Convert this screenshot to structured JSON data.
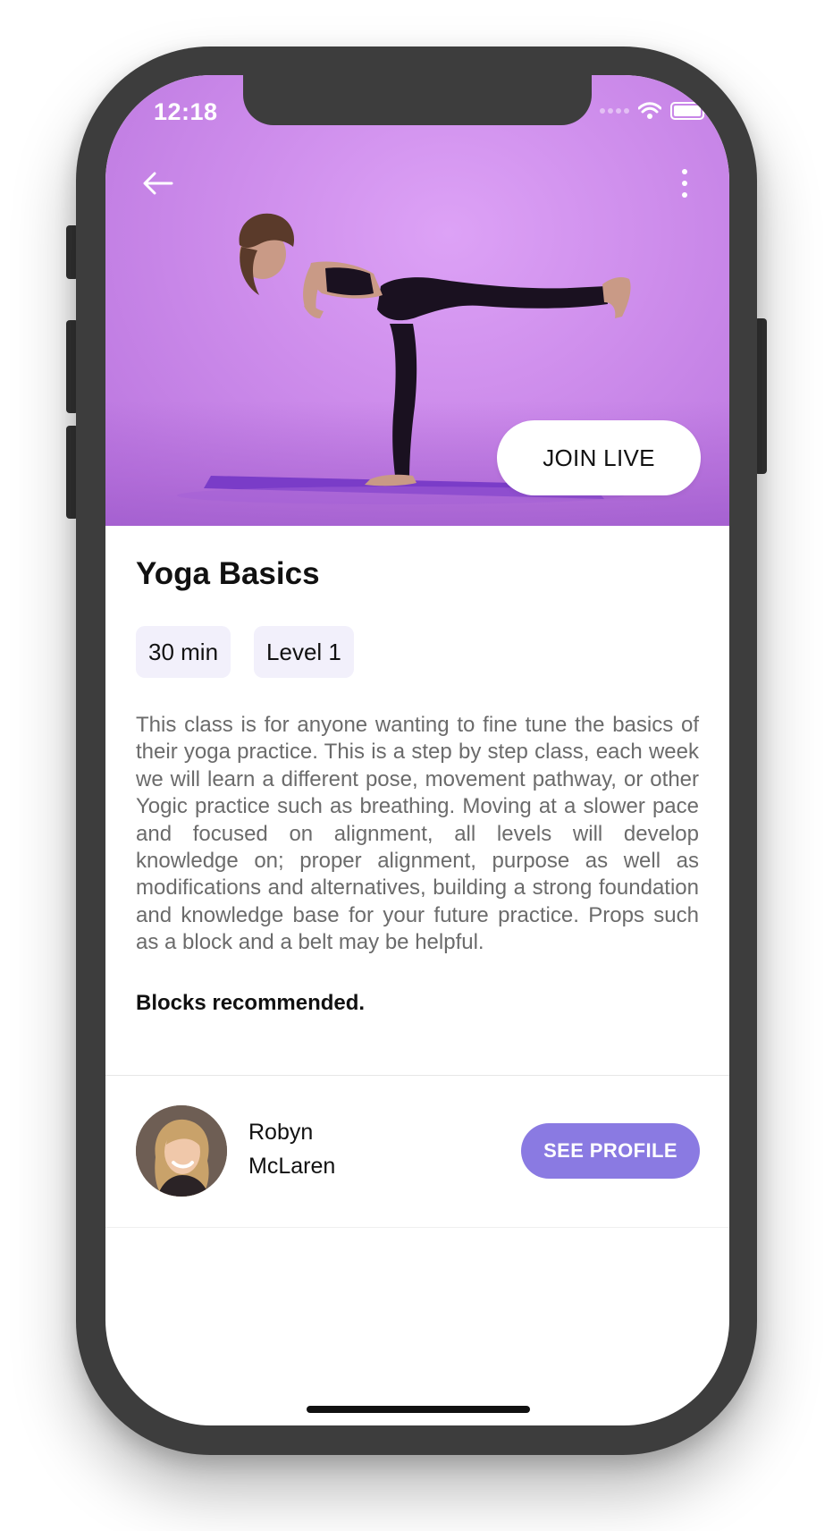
{
  "status_bar": {
    "time": "12:18",
    "icons": [
      "signal-dots-icon",
      "wifi-icon",
      "battery-icon"
    ]
  },
  "hero": {
    "back_icon": "arrow-left-icon",
    "more_icon": "more-vertical-icon",
    "join_label": "JOIN LIVE",
    "background_color": "#cd8ceb"
  },
  "class_info": {
    "title": "Yoga Basics",
    "tags": [
      "30 min",
      "Level 1"
    ],
    "description": "This class is for anyone wanting to fine tune the basics of their yoga practice. This is a step by step class, each week we will learn a different pose, movement pathway, or other Yogic practice such as breathing. Moving at a slower pace and focused on alignment, all levels will develop knowledge on; proper alignment, purpose as well as modifications and alternatives, building a strong foundation and knowledge base for your future practice. Props such as a block and a belt may be helpful.",
    "note": "Blocks recommended."
  },
  "instructor": {
    "first_name": "Robyn",
    "last_name": "McLaren",
    "profile_label": "SEE PROFILE",
    "accent_color": "#8a7ae2"
  }
}
